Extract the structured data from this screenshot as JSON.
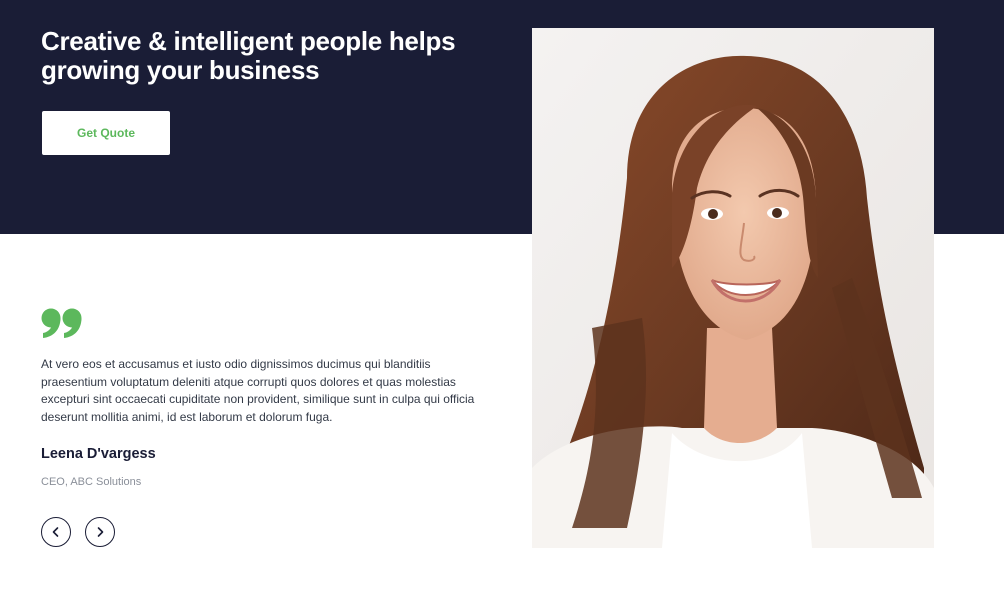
{
  "hero": {
    "headline": "Creative & intelligent people helps growing your business",
    "cta_label": "Get Quote"
  },
  "testimonial": {
    "quote_text": "At vero eos et accusamus et iusto odio dignissimos ducimus qui blanditiis praesentium voluptatum deleniti atque corrupti quos dolores et quas molestias excepturi sint occaecati cupiditate non provident, similique sunt in culpa qui officia deserunt mollitia animi, id est laborum et dolorum fuga.",
    "author_name": "Leena D'vargess",
    "author_role": "CEO, ABC Solutions"
  },
  "icons": {
    "quote": "quote-icon",
    "prev": "chevron-left-icon",
    "next": "chevron-right-icon"
  },
  "colors": {
    "hero_bg": "#1a1d36",
    "accent": "#5cb85c",
    "text": "#333a47",
    "muted": "#8a8f99"
  }
}
